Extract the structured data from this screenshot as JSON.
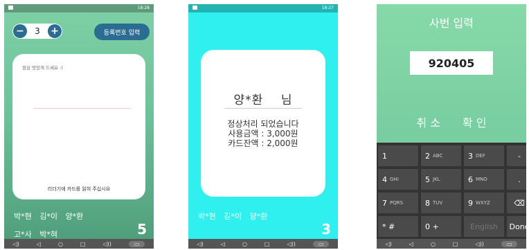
{
  "phone1": {
    "status_time": "18:28",
    "stepper_value": "3",
    "stepper_minus": "−",
    "stepper_plus": "+",
    "register_button": "등록번호 입력",
    "greeting": "점심 맛있게 드세요 :)",
    "prompt": "리더기에 카드를 읽혀 주십시요",
    "names_row1": [
      "박*현",
      "김*이",
      "양*환"
    ],
    "names_row2": [
      "고*사",
      "박*혀"
    ],
    "count": "5"
  },
  "phone2": {
    "status_time": "18:27",
    "person": "양*환",
    "honorific": "님",
    "msg_line1": "정상처리 되었습니다",
    "msg_line2": "사용금액 :   3,000원",
    "msg_line3": "카드잔액 :   2,000원",
    "names": [
      "박*현",
      "김*이",
      "양*환"
    ],
    "count": "3"
  },
  "phone3": {
    "title": "사번 입력",
    "input_value": "920405",
    "cancel": "취 소",
    "confirm": "확 인",
    "keys": [
      {
        "main": "1",
        "sub": ""
      },
      {
        "main": "2",
        "sub": "ABC"
      },
      {
        "main": "3",
        "sub": "DEF"
      },
      {
        "main": "-",
        "sub": ""
      },
      {
        "main": "4",
        "sub": "GHI"
      },
      {
        "main": "5",
        "sub": "JKL"
      },
      {
        "main": "6",
        "sub": "MNO"
      },
      {
        "main": ".",
        "sub": ""
      },
      {
        "main": "7",
        "sub": "PQRS"
      },
      {
        "main": "8",
        "sub": "TUV"
      },
      {
        "main": "9",
        "sub": "WXYZ"
      },
      {
        "main": "⌫",
        "sub": ""
      },
      {
        "main": "* #",
        "sub": ""
      },
      {
        "main": "0 +",
        "sub": ""
      },
      {
        "main": "English",
        "sub": ""
      },
      {
        "main": "Done",
        "sub": ""
      }
    ]
  },
  "nav": {
    "back": "◁",
    "home": "○",
    "recent": "□",
    "vol_down": "◁)",
    "vol_up": "◁))",
    "keyboard": "▭"
  }
}
